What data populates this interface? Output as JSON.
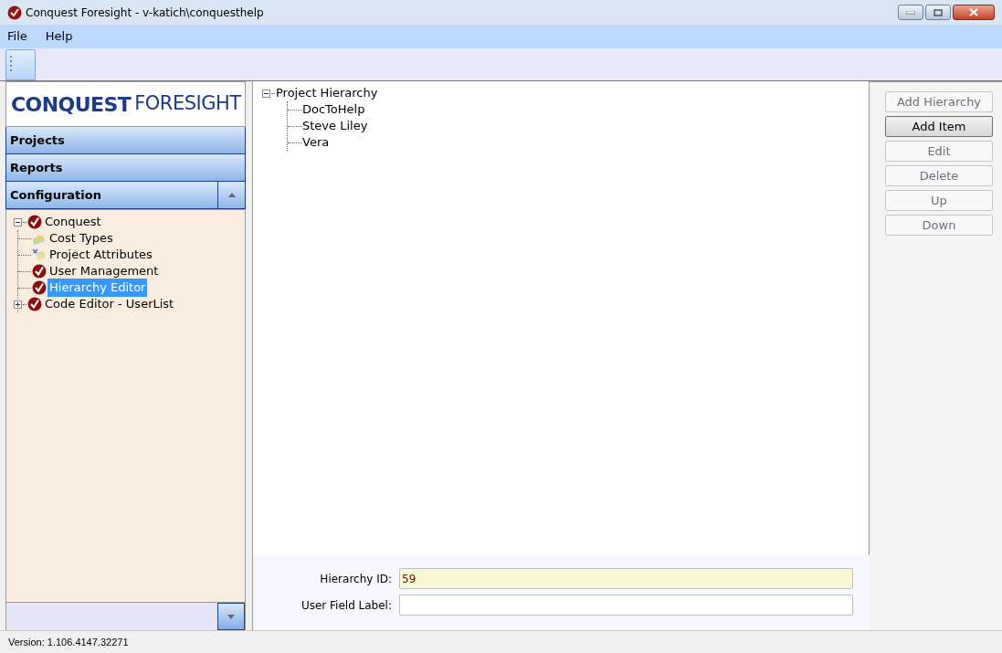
{
  "window": {
    "title": "Conquest Foresight - v-katich\\conquesthelp"
  },
  "menu": [
    "File",
    "Help"
  ],
  "logo": {
    "left": "CONQUEST",
    "right": "FORESIGHT"
  },
  "nav_sections": [
    {
      "label": "Projects",
      "expanded": false
    },
    {
      "label": "Reports",
      "expanded": false
    },
    {
      "label": "Configuration",
      "expanded": true
    }
  ],
  "config_tree": [
    {
      "label": "Conquest",
      "kind": "check",
      "expanded": true,
      "selected": false,
      "children": [
        {
          "label": "Cost Types",
          "kind": "money",
          "selected": false
        },
        {
          "label": "Project Attributes",
          "kind": "attributes",
          "selected": false
        },
        {
          "label": "User Management",
          "kind": "check",
          "selected": false
        },
        {
          "label": "Hierarchy Editor",
          "kind": "check",
          "selected": true
        },
        {
          "label": "Code Editor - UserList",
          "kind": "check",
          "expanded": false,
          "selected": false
        }
      ]
    }
  ],
  "hierarchy_tree": {
    "label": "Project Hierarchy",
    "expanded": true,
    "children": [
      "DocToHelp",
      "Steve Liley",
      "Vera"
    ]
  },
  "buttons": [
    {
      "label": "Add Hierarchy",
      "disabled": true
    },
    {
      "label": "Add Item",
      "disabled": false
    },
    {
      "label": "Edit",
      "disabled": true
    },
    {
      "label": "Delete",
      "disabled": true
    },
    {
      "label": "Up",
      "disabled": true
    },
    {
      "label": "Down",
      "disabled": true
    }
  ],
  "fields": [
    {
      "label": "Hierarchy ID:",
      "value": "59",
      "readonly": true
    },
    {
      "label": "User Field Label:",
      "readonly": false
    }
  ],
  "status_bar": "Version: 1.106.4147.32271"
}
